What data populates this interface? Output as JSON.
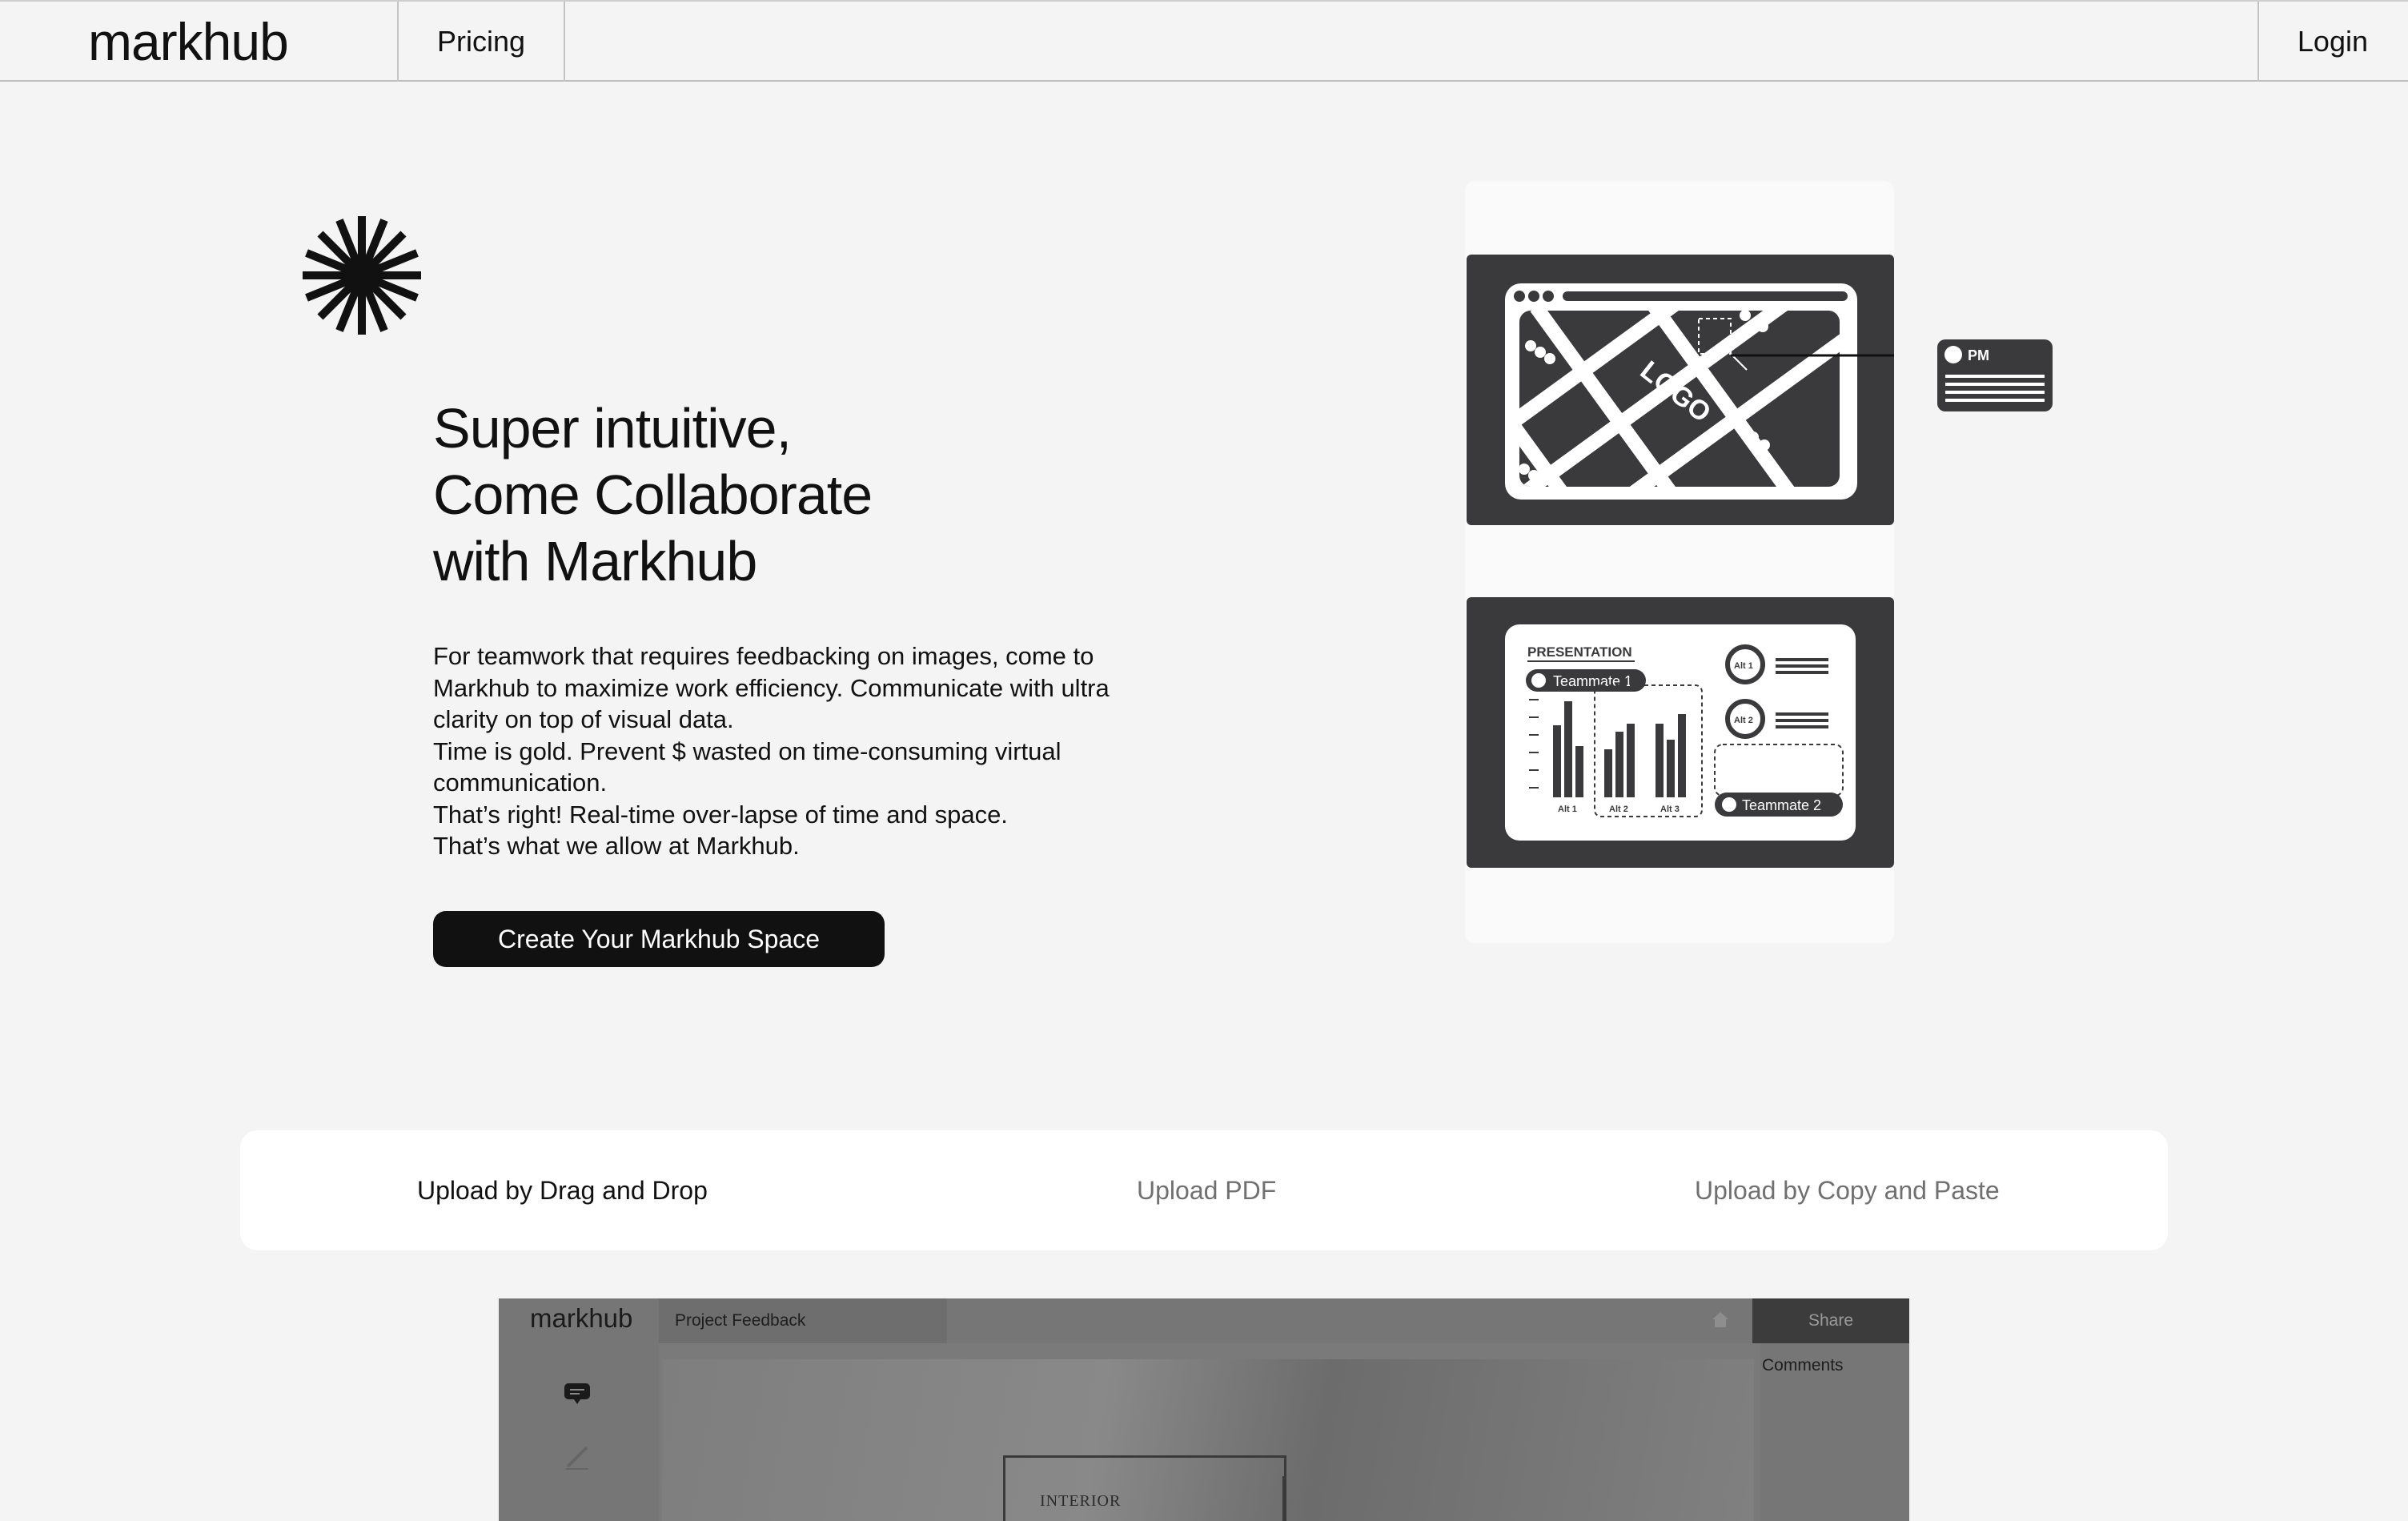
{
  "nav": {
    "logo": "markhub",
    "pricing": "Pricing",
    "login": "Login"
  },
  "hero": {
    "title_lines": [
      "Super intuitive,",
      "Come Collaborate",
      "with Markhub"
    ],
    "description_lines": [
      "For teamwork that requires feedbacking on images, come to",
      "Markhub to maximize work efficiency. Communicate with ultra",
      "clarity on top of visual data.",
      "Time is gold. Prevent $ wasted on time-consuming virtual",
      "communication.",
      "That’s right! Real-time over-lapse of time and space.",
      "That’s what we allow at Markhub."
    ],
    "cta": "Create Your Markhub Space"
  },
  "illustration": {
    "logo_tile": "LOGO",
    "pm_label": "PM",
    "presentation_title": "PRESENTATION",
    "teammate1": "Teammate 1",
    "teammate2": "Teammate 2",
    "alt1": "Alt 1",
    "alt2": "Alt 2",
    "alt3": "Alt 3"
  },
  "upload_tabs": [
    {
      "label": "Upload by Drag and Drop",
      "active": true
    },
    {
      "label": "Upload PDF",
      "active": false
    },
    {
      "label": "Upload by Copy and Paste",
      "active": false
    }
  ],
  "demo": {
    "logo": "markhub",
    "project": "Project Feedback",
    "share": "Share",
    "comments": "Comments",
    "canvas_text": "INTERIOR"
  },
  "colors": {
    "background": "#f4f4f4",
    "dark": "#3a3a3c",
    "cta": "#111111",
    "muted_tab": "#707070"
  },
  "icons": [
    "asterisk-icon",
    "home-icon",
    "comment-tool-icon",
    "pen-tool-icon"
  ]
}
